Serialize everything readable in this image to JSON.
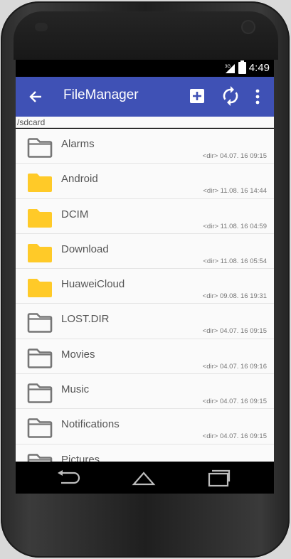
{
  "status": {
    "time": "4:49",
    "network": "3G"
  },
  "appbar": {
    "title": "FileManager",
    "back_icon": "arrow-back-icon",
    "add_icon": "add-box-icon",
    "sync_icon": "sync-icon",
    "more_icon": "more-vert-icon"
  },
  "path": "/sdcard",
  "colors": {
    "appbar": "#3f51b5",
    "folder_yellow": "#FFCA28",
    "folder_gray": "#757575"
  },
  "files": [
    {
      "name": "Alarms",
      "meta": "<dir>  04.07. 16 09:15",
      "icon": "folder-outline-icon"
    },
    {
      "name": "Android",
      "meta": "<dir>  11.08. 16 14:44",
      "icon": "folder-filled-icon"
    },
    {
      "name": "DCIM",
      "meta": "<dir>  11.08. 16 04:59",
      "icon": "folder-filled-icon"
    },
    {
      "name": "Download",
      "meta": "<dir>  11.08. 16 05:54",
      "icon": "folder-filled-icon"
    },
    {
      "name": "HuaweiCloud",
      "meta": "<dir>  09.08. 16 19:31",
      "icon": "folder-filled-icon"
    },
    {
      "name": "LOST.DIR",
      "meta": "<dir>  04.07. 16 09:15",
      "icon": "folder-outline-icon"
    },
    {
      "name": "Movies",
      "meta": "<dir>  04.07. 16 09:16",
      "icon": "folder-outline-icon"
    },
    {
      "name": "Music",
      "meta": "<dir>  04.07. 16 09:15",
      "icon": "folder-outline-icon"
    },
    {
      "name": "Notifications",
      "meta": "<dir>  04.07. 16 09:15",
      "icon": "folder-outline-icon"
    },
    {
      "name": "Pictures",
      "meta": "",
      "icon": "folder-outline-icon"
    }
  ],
  "nav": {
    "back": "nav-back-icon",
    "home": "nav-home-icon",
    "recents": "nav-recents-icon"
  }
}
